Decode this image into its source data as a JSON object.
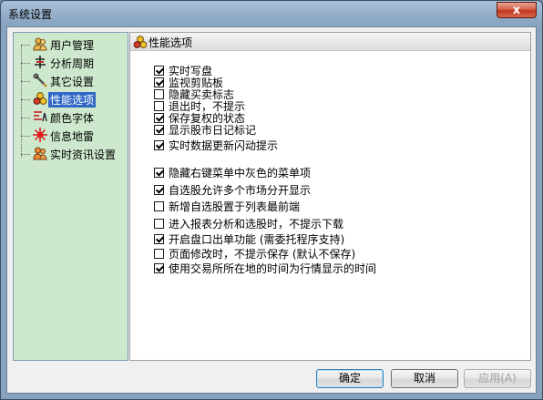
{
  "window": {
    "title": "系统设置",
    "close_glyph": "x"
  },
  "tree": {
    "items": [
      {
        "label": "用户管理",
        "icon": "users-icon"
      },
      {
        "label": "分析周期",
        "icon": "period-icon"
      },
      {
        "label": "其它设置",
        "icon": "tools-icon"
      },
      {
        "label": "性能选项",
        "icon": "performance-icon",
        "selected": true
      },
      {
        "label": "颜色字体",
        "icon": "font-color-icon"
      },
      {
        "label": "信息地雷",
        "icon": "mine-icon"
      },
      {
        "label": "实时资讯设置",
        "icon": "news-icon"
      }
    ]
  },
  "panel": {
    "title": "性能选项",
    "options": [
      {
        "label": "实时写盘",
        "checked": true
      },
      {
        "label": "监视剪贴板",
        "checked": true
      },
      {
        "label": "隐藏买卖标志",
        "checked": false
      },
      {
        "label": "退出时，不提示",
        "checked": false
      },
      {
        "label": "保存复权的状态",
        "checked": true
      },
      {
        "label": "显示股市日记标记",
        "checked": true
      },
      {
        "label": "实时数据更新闪动提示",
        "checked": true
      },
      {
        "label": "隐藏右键菜单中灰色的菜单项",
        "checked": true
      },
      {
        "label": "自选股允许多个市场分开显示",
        "checked": true
      },
      {
        "label": "新增自选股置于列表最前端",
        "checked": false
      },
      {
        "label": "进入报表分析和选股时，不提示下载",
        "checked": false
      },
      {
        "label": "开启盘口出单功能 (需委托程序支持)",
        "checked": true
      },
      {
        "label": "页面修改时，不提示保存 (默认不保存)",
        "checked": false
      },
      {
        "label": "使用交易所所在地的时间为行情显示的时间",
        "checked": true
      }
    ]
  },
  "buttons": {
    "ok": "确定",
    "cancel": "取消",
    "apply": "应用(A)"
  }
}
